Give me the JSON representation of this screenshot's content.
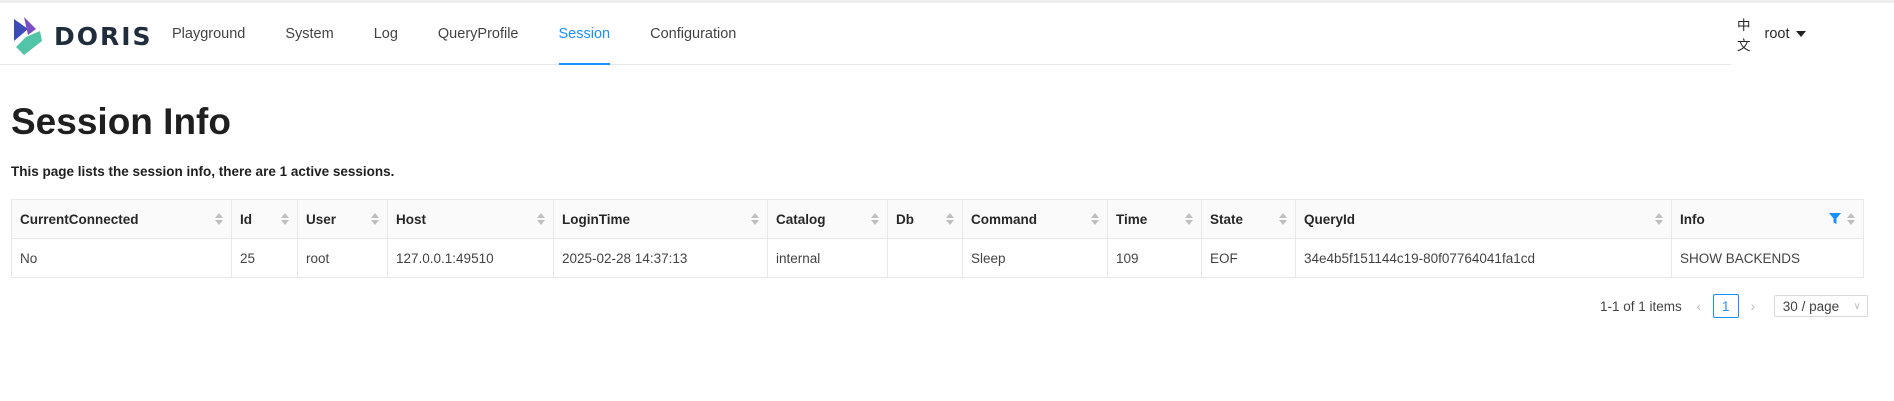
{
  "app": {
    "logo_text": "DORIS"
  },
  "nav": {
    "items": [
      {
        "label": "Playground"
      },
      {
        "label": "System"
      },
      {
        "label": "Log"
      },
      {
        "label": "QueryProfile"
      },
      {
        "label": "Session"
      },
      {
        "label": "Configuration"
      }
    ],
    "active": "Session"
  },
  "header": {
    "language": "中文",
    "user": "root"
  },
  "page": {
    "title": "Session Info",
    "description": "This page lists the session info, there are 1 active sessions."
  },
  "table": {
    "columns": [
      "CurrentConnected",
      "Id",
      "User",
      "Host",
      "LoginTime",
      "Catalog",
      "Db",
      "Command",
      "Time",
      "State",
      "QueryId",
      "Info"
    ],
    "rows": [
      [
        "No",
        "25",
        "root",
        "127.0.0.1:49510",
        "2025-02-28 14:37:13",
        "internal",
        "",
        "Sleep",
        "109",
        "EOF",
        "34e4b5f151144c19-80f07764041fa1cd",
        "SHOW BACKENDS"
      ]
    ]
  },
  "pagination": {
    "total_text": "1-1 of 1 items",
    "current_page": "1",
    "page_size": "30 / page"
  },
  "colors": {
    "accent": "#1890ff",
    "logo_blue": "#3b4bb8",
    "logo_purple": "#7b4fc1",
    "logo_teal": "#52c4a8"
  }
}
